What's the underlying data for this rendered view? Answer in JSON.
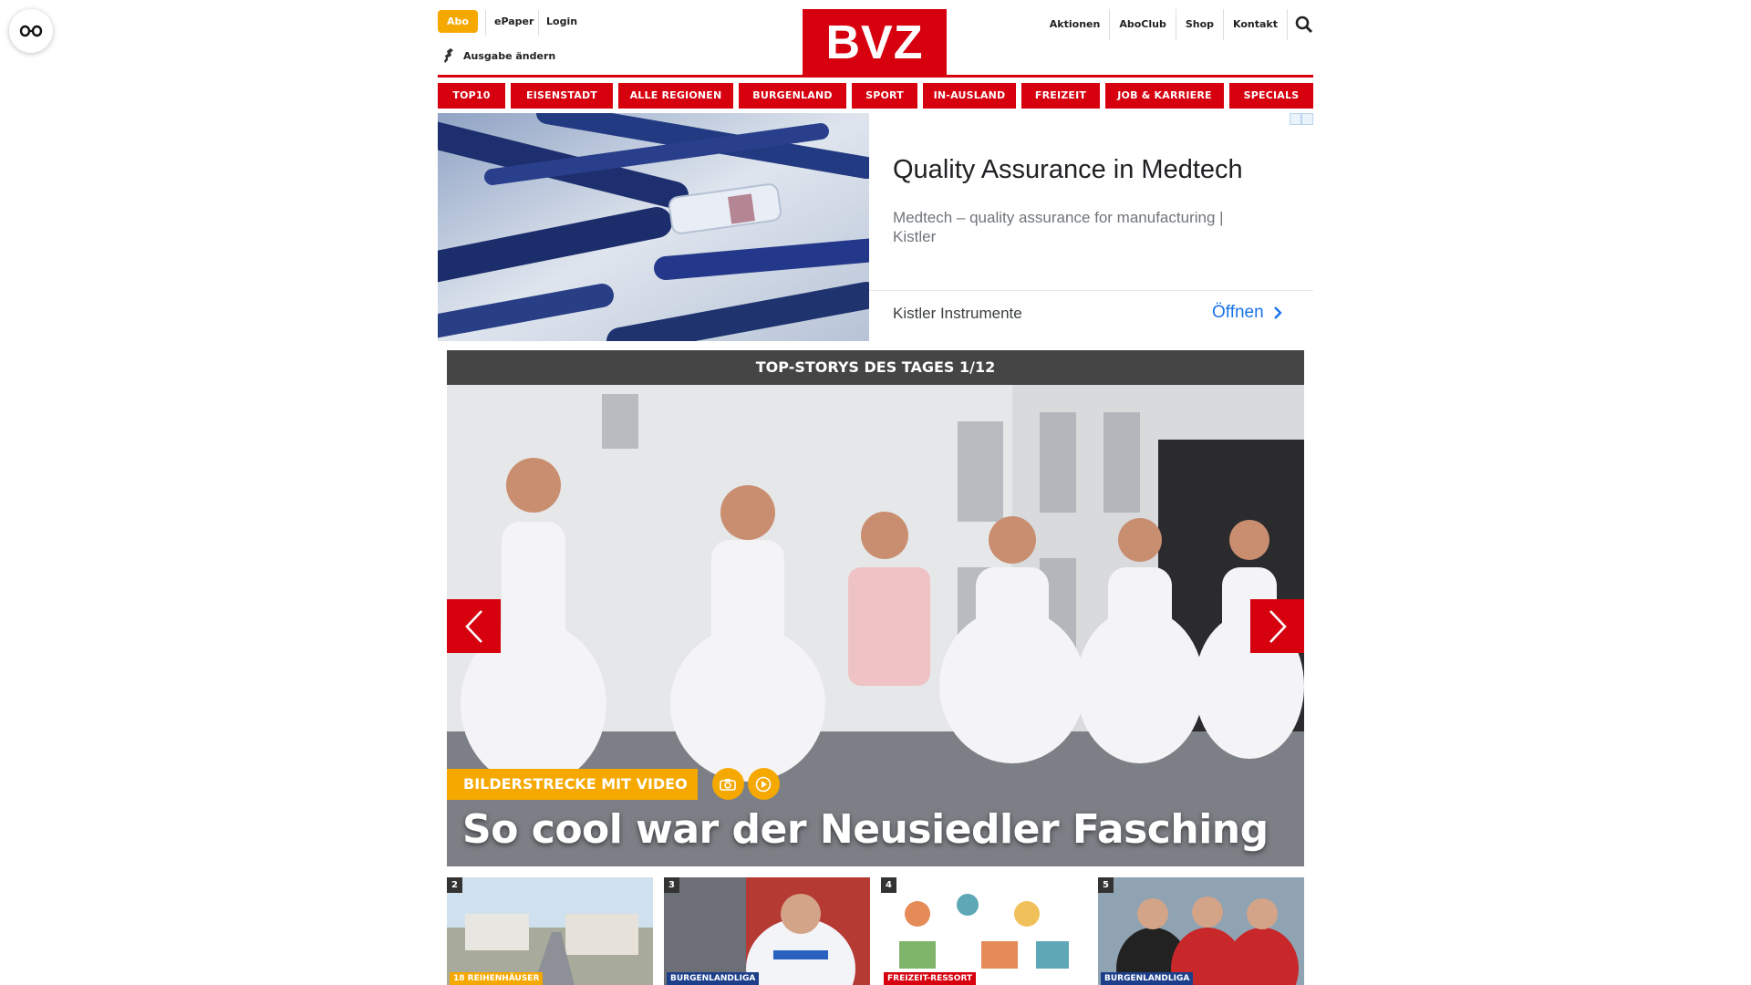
{
  "header": {
    "abo_label": "Abo",
    "epaper_label": "ePaper",
    "login_label": "Login",
    "edition_label": "Ausgabe ändern",
    "logo_text": "BVZ",
    "right_nav": [
      "Aktionen",
      "AboClub",
      "Shop",
      "Kontakt"
    ]
  },
  "nav": {
    "tabs": [
      "TOP10",
      "EISENSTADT",
      "ALLE REGIONEN",
      "BURGENLAND",
      "SPORT",
      "IN-AUSLAND",
      "FREIZEIT",
      "JOB & KARRIERE",
      "SPECIALS"
    ]
  },
  "ad": {
    "title": "Quality Assurance in Medtech",
    "description": "Medtech – quality assurance for manufacturing | Kistler",
    "advertiser": "Kistler Instrumente",
    "cta": "Öffnen"
  },
  "top_stories": {
    "heading": "TOP-STORYS DES TAGES 1/12",
    "kicker": "BILDERSTRECKE MIT VIDEO",
    "headline": "So cool war der Neusiedler Fasching"
  },
  "thumbnails": [
    {
      "num": "2",
      "tag": "18 REIHENHÄUSER"
    },
    {
      "num": "3",
      "tag": "BURGENLANDLIGA"
    },
    {
      "num": "4",
      "tag": "FREIZEIT-RESSORT"
    },
    {
      "num": "5",
      "tag": "BURGENLANDLIGA"
    }
  ],
  "colors": {
    "brand_red": "#d6000f",
    "accent_yellow": "#f5a800",
    "header_dark": "#454545"
  }
}
